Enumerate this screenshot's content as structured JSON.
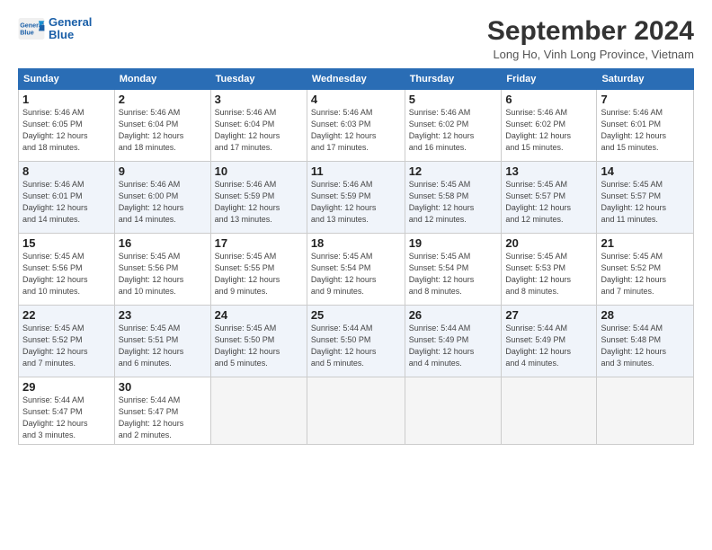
{
  "logo": {
    "line1": "General",
    "line2": "Blue"
  },
  "title": "September 2024",
  "location": "Long Ho, Vinh Long Province, Vietnam",
  "headers": [
    "Sunday",
    "Monday",
    "Tuesday",
    "Wednesday",
    "Thursday",
    "Friday",
    "Saturday"
  ],
  "weeks": [
    [
      {
        "day": "1",
        "info": "Sunrise: 5:46 AM\nSunset: 6:05 PM\nDaylight: 12 hours\nand 18 minutes."
      },
      {
        "day": "2",
        "info": "Sunrise: 5:46 AM\nSunset: 6:04 PM\nDaylight: 12 hours\nand 18 minutes."
      },
      {
        "day": "3",
        "info": "Sunrise: 5:46 AM\nSunset: 6:04 PM\nDaylight: 12 hours\nand 17 minutes."
      },
      {
        "day": "4",
        "info": "Sunrise: 5:46 AM\nSunset: 6:03 PM\nDaylight: 12 hours\nand 17 minutes."
      },
      {
        "day": "5",
        "info": "Sunrise: 5:46 AM\nSunset: 6:02 PM\nDaylight: 12 hours\nand 16 minutes."
      },
      {
        "day": "6",
        "info": "Sunrise: 5:46 AM\nSunset: 6:02 PM\nDaylight: 12 hours\nand 15 minutes."
      },
      {
        "day": "7",
        "info": "Sunrise: 5:46 AM\nSunset: 6:01 PM\nDaylight: 12 hours\nand 15 minutes."
      }
    ],
    [
      {
        "day": "8",
        "info": "Sunrise: 5:46 AM\nSunset: 6:01 PM\nDaylight: 12 hours\nand 14 minutes."
      },
      {
        "day": "9",
        "info": "Sunrise: 5:46 AM\nSunset: 6:00 PM\nDaylight: 12 hours\nand 14 minutes."
      },
      {
        "day": "10",
        "info": "Sunrise: 5:46 AM\nSunset: 5:59 PM\nDaylight: 12 hours\nand 13 minutes."
      },
      {
        "day": "11",
        "info": "Sunrise: 5:46 AM\nSunset: 5:59 PM\nDaylight: 12 hours\nand 13 minutes."
      },
      {
        "day": "12",
        "info": "Sunrise: 5:45 AM\nSunset: 5:58 PM\nDaylight: 12 hours\nand 12 minutes."
      },
      {
        "day": "13",
        "info": "Sunrise: 5:45 AM\nSunset: 5:57 PM\nDaylight: 12 hours\nand 12 minutes."
      },
      {
        "day": "14",
        "info": "Sunrise: 5:45 AM\nSunset: 5:57 PM\nDaylight: 12 hours\nand 11 minutes."
      }
    ],
    [
      {
        "day": "15",
        "info": "Sunrise: 5:45 AM\nSunset: 5:56 PM\nDaylight: 12 hours\nand 10 minutes."
      },
      {
        "day": "16",
        "info": "Sunrise: 5:45 AM\nSunset: 5:56 PM\nDaylight: 12 hours\nand 10 minutes."
      },
      {
        "day": "17",
        "info": "Sunrise: 5:45 AM\nSunset: 5:55 PM\nDaylight: 12 hours\nand 9 minutes."
      },
      {
        "day": "18",
        "info": "Sunrise: 5:45 AM\nSunset: 5:54 PM\nDaylight: 12 hours\nand 9 minutes."
      },
      {
        "day": "19",
        "info": "Sunrise: 5:45 AM\nSunset: 5:54 PM\nDaylight: 12 hours\nand 8 minutes."
      },
      {
        "day": "20",
        "info": "Sunrise: 5:45 AM\nSunset: 5:53 PM\nDaylight: 12 hours\nand 8 minutes."
      },
      {
        "day": "21",
        "info": "Sunrise: 5:45 AM\nSunset: 5:52 PM\nDaylight: 12 hours\nand 7 minutes."
      }
    ],
    [
      {
        "day": "22",
        "info": "Sunrise: 5:45 AM\nSunset: 5:52 PM\nDaylight: 12 hours\nand 7 minutes."
      },
      {
        "day": "23",
        "info": "Sunrise: 5:45 AM\nSunset: 5:51 PM\nDaylight: 12 hours\nand 6 minutes."
      },
      {
        "day": "24",
        "info": "Sunrise: 5:45 AM\nSunset: 5:50 PM\nDaylight: 12 hours\nand 5 minutes."
      },
      {
        "day": "25",
        "info": "Sunrise: 5:44 AM\nSunset: 5:50 PM\nDaylight: 12 hours\nand 5 minutes."
      },
      {
        "day": "26",
        "info": "Sunrise: 5:44 AM\nSunset: 5:49 PM\nDaylight: 12 hours\nand 4 minutes."
      },
      {
        "day": "27",
        "info": "Sunrise: 5:44 AM\nSunset: 5:49 PM\nDaylight: 12 hours\nand 4 minutes."
      },
      {
        "day": "28",
        "info": "Sunrise: 5:44 AM\nSunset: 5:48 PM\nDaylight: 12 hours\nand 3 minutes."
      }
    ],
    [
      {
        "day": "29",
        "info": "Sunrise: 5:44 AM\nSunset: 5:47 PM\nDaylight: 12 hours\nand 3 minutes."
      },
      {
        "day": "30",
        "info": "Sunrise: 5:44 AM\nSunset: 5:47 PM\nDaylight: 12 hours\nand 2 minutes."
      },
      {
        "day": "",
        "info": ""
      },
      {
        "day": "",
        "info": ""
      },
      {
        "day": "",
        "info": ""
      },
      {
        "day": "",
        "info": ""
      },
      {
        "day": "",
        "info": ""
      }
    ]
  ]
}
